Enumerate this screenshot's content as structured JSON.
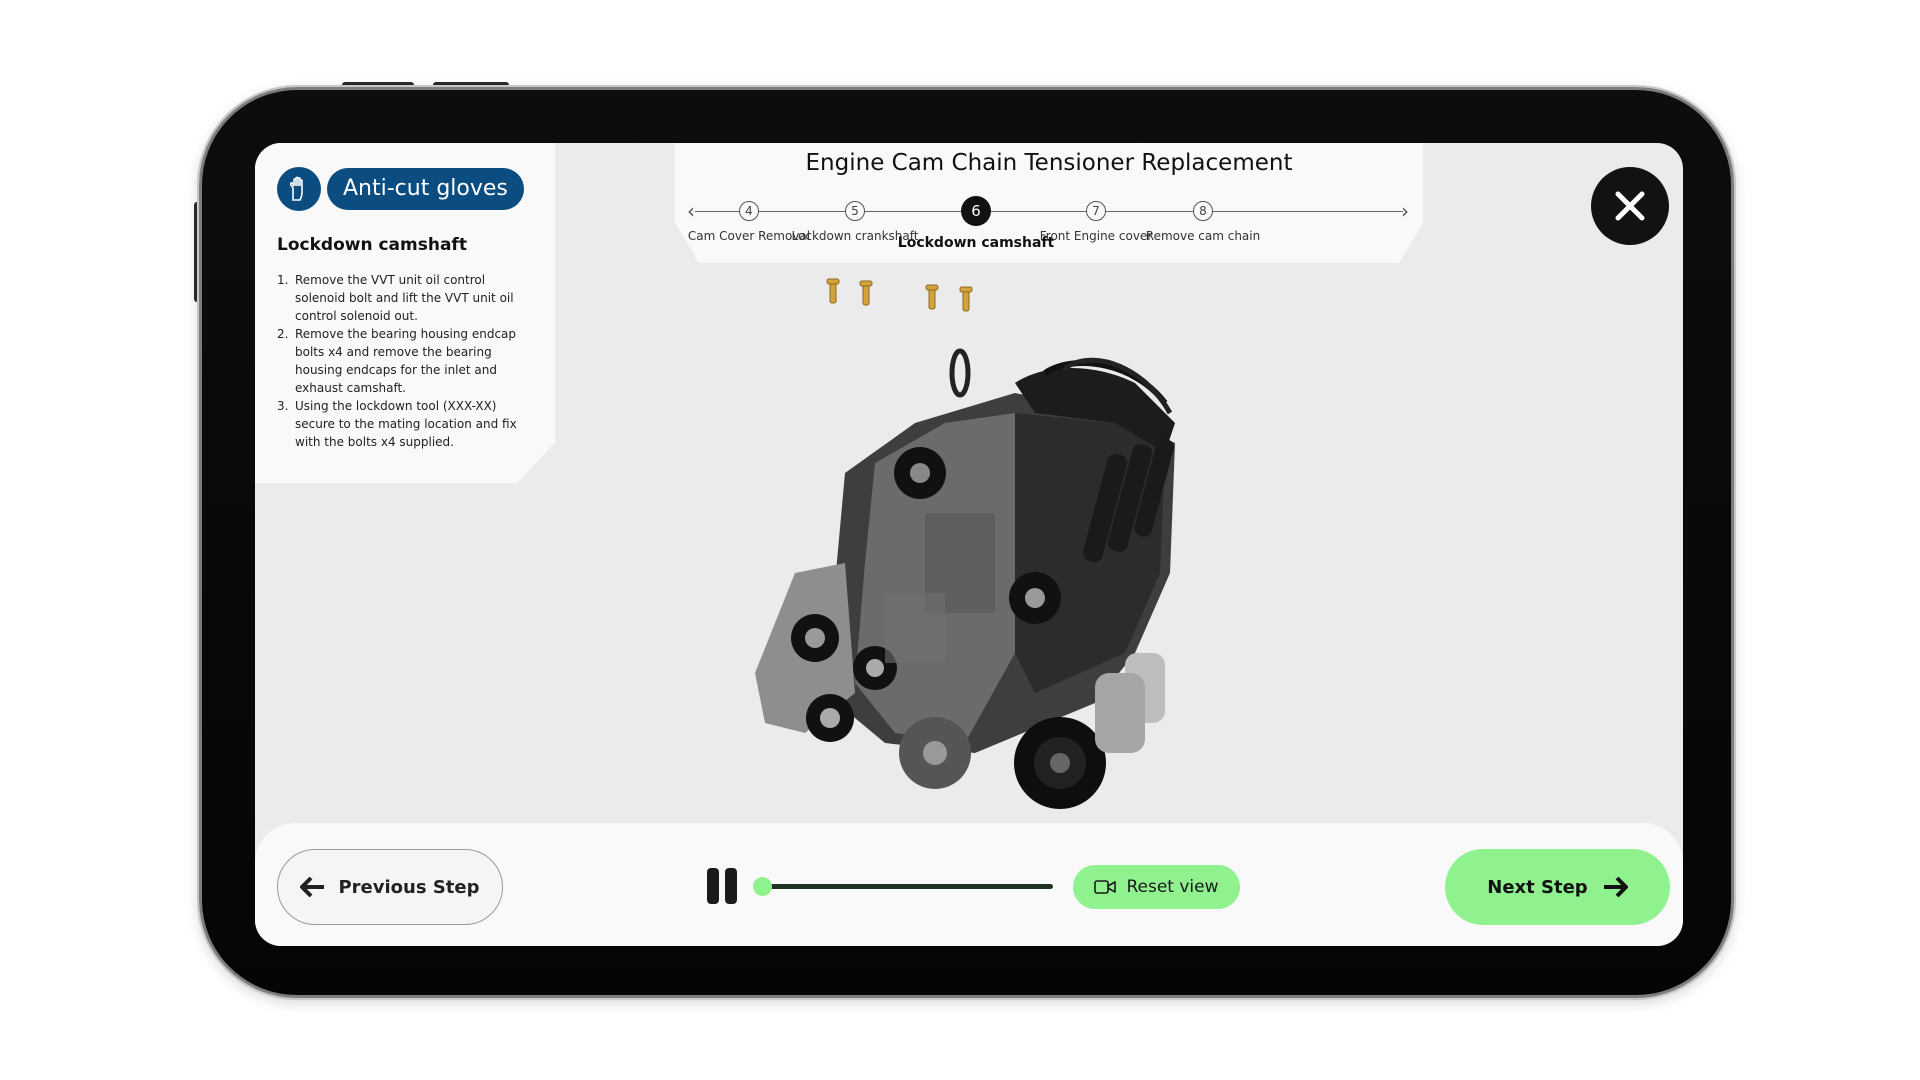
{
  "ppe": {
    "label": "Anti-cut gloves",
    "icon": "hand-glove-icon",
    "color": "#0b4d80"
  },
  "procedure": {
    "title": "Engine Cam Chain Tensioner Replacement",
    "steps": [
      {
        "number": "4",
        "label": "Cam Cover Removal"
      },
      {
        "number": "5",
        "label": "Lockdown crankshaft"
      },
      {
        "number": "6",
        "label": "Lockdown camshaft",
        "active": true
      },
      {
        "number": "7",
        "label": "Front Engine cover"
      },
      {
        "number": "8",
        "label": "Remove cam chain"
      }
    ]
  },
  "instructions": {
    "title": "Lockdown camshaft",
    "items": [
      {
        "num": "1.",
        "text": "Remove the VVT unit oil control solenoid bolt and lift the VVT unit oil control solenoid out."
      },
      {
        "num": "2.",
        "text": "Remove the bearing housing endcap bolts x4 and remove the bearing housing endcaps for the inlet and exhaust camshaft."
      },
      {
        "num": "3.",
        "text": "Using the lockdown tool (XXX-XX) secure to the mating location and fix with the bolts x4 supplied."
      }
    ]
  },
  "controls": {
    "prev_label": "Previous Step",
    "next_label": "Next Step",
    "reset_label": "Reset view",
    "playback_progress": 0.0
  },
  "colors": {
    "accent_green": "#8ff28f",
    "dark": "#121212",
    "screen_bg": "#ebebeb"
  }
}
